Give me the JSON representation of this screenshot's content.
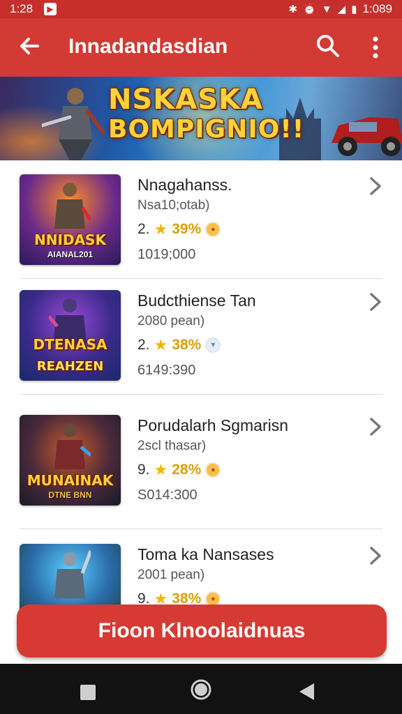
{
  "status_bar": {
    "time": "1:28",
    "right_time": "1:089",
    "notification_icon": "app-notification-icon"
  },
  "app_bar": {
    "title": "Innadandasdian"
  },
  "banner": {
    "line1": "NSKASKA",
    "line2": "BOMPIGNIO!!"
  },
  "items": [
    {
      "name": "Nnagahanss.",
      "sub": "Nsa10;otab)",
      "rating": "2.",
      "percent": "39%",
      "downloads": "1019;000",
      "thumb_title": "NNIDASK",
      "thumb_sub": "AIANAL201",
      "badge_style": "orange"
    },
    {
      "name": "Budcthiense Tan",
      "sub": "2080 pean)",
      "rating": "2.",
      "percent": "38%",
      "downloads": "6149:390",
      "thumb_title": "DTENASA",
      "thumb_sub": "REAHZEN",
      "badge_style": "grey"
    },
    {
      "name": "Porudalarh Sgmarisn",
      "sub": "2scl thasar)",
      "rating": "9.",
      "percent": "28%",
      "downloads": "S014:300",
      "thumb_title": "MUNAINAK",
      "thumb_sub": "DTNE BNN",
      "badge_style": "orange"
    },
    {
      "name": "Toma ka Nansases",
      "sub": "2001 pean)",
      "rating": "9.",
      "percent": "38%",
      "downloads": "",
      "thumb_title": "",
      "thumb_sub": "",
      "badge_style": "orange"
    }
  ],
  "cta": {
    "label": "Fioon Klnoolaidnuas"
  },
  "colors": {
    "primary": "#d23a33",
    "status": "#c62f2c",
    "star": "#f2b500",
    "nav": "#121212"
  }
}
